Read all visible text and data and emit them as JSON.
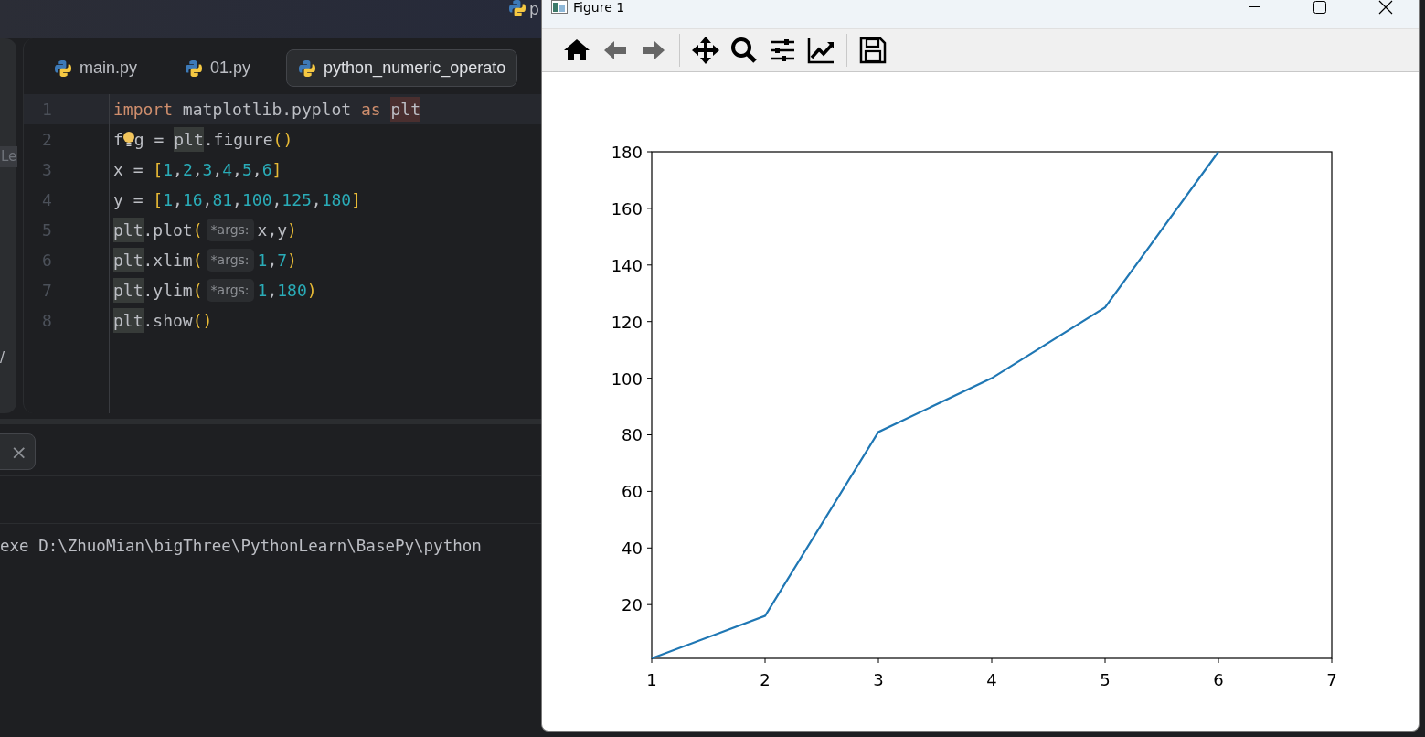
{
  "ide": {
    "title_fragment": "p",
    "side_label": "Le",
    "side_mark": "/",
    "tabs": [
      {
        "label": "main.py",
        "selected": false
      },
      {
        "label": "01.py",
        "selected": false
      },
      {
        "label": "python_numeric_operato",
        "selected": true
      }
    ],
    "code": [
      {
        "number": "1",
        "current": true,
        "tokens": [
          {
            "text": "import",
            "kind": "keyword"
          },
          {
            "text": " matplotlib.pyplot ",
            "kind": "plain"
          },
          {
            "text": "as ",
            "kind": "keyword"
          },
          {
            "text": "plt",
            "kind": "marked"
          }
        ]
      },
      {
        "number": "2",
        "current": false,
        "tokens": [
          {
            "text": "f",
            "kind": "plain"
          },
          {
            "kind": "bulb"
          },
          {
            "text": "g = ",
            "kind": "plain"
          },
          {
            "text": "plt",
            "kind": "usage"
          },
          {
            "text": ".figure",
            "kind": "plain"
          },
          {
            "text": "()",
            "kind": "bracket"
          }
        ]
      },
      {
        "number": "3",
        "current": false,
        "tokens": [
          {
            "text": "x = ",
            "kind": "plain"
          },
          {
            "text": "[",
            "kind": "bracket"
          },
          {
            "text": "1",
            "kind": "number"
          },
          {
            "text": ",",
            "kind": "plain"
          },
          {
            "text": "2",
            "kind": "number"
          },
          {
            "text": ",",
            "kind": "plain"
          },
          {
            "text": "3",
            "kind": "number"
          },
          {
            "text": ",",
            "kind": "plain"
          },
          {
            "text": "4",
            "kind": "number"
          },
          {
            "text": ",",
            "kind": "plain"
          },
          {
            "text": "5",
            "kind": "number"
          },
          {
            "text": ",",
            "kind": "plain"
          },
          {
            "text": "6",
            "kind": "number"
          },
          {
            "text": "]",
            "kind": "bracket"
          }
        ]
      },
      {
        "number": "4",
        "current": false,
        "tokens": [
          {
            "text": "y = ",
            "kind": "plain"
          },
          {
            "text": "[",
            "kind": "bracket"
          },
          {
            "text": "1",
            "kind": "number"
          },
          {
            "text": ",",
            "kind": "plain"
          },
          {
            "text": "16",
            "kind": "number"
          },
          {
            "text": ",",
            "kind": "plain"
          },
          {
            "text": "81",
            "kind": "number"
          },
          {
            "text": ",",
            "kind": "plain"
          },
          {
            "text": "100",
            "kind": "number"
          },
          {
            "text": ",",
            "kind": "plain"
          },
          {
            "text": "125",
            "kind": "number"
          },
          {
            "text": ",",
            "kind": "plain"
          },
          {
            "text": "180",
            "kind": "number"
          },
          {
            "text": "]",
            "kind": "bracket"
          }
        ]
      },
      {
        "number": "5",
        "current": false,
        "tokens": [
          {
            "text": "plt",
            "kind": "usage"
          },
          {
            "text": ".plot",
            "kind": "plain"
          },
          {
            "text": "(",
            "kind": "bracket"
          },
          {
            "text": "*args:",
            "kind": "hint"
          },
          {
            "text": "x,y",
            "kind": "plain"
          },
          {
            "text": ")",
            "kind": "bracket"
          }
        ]
      },
      {
        "number": "6",
        "current": false,
        "tokens": [
          {
            "text": "plt",
            "kind": "usage"
          },
          {
            "text": ".xlim",
            "kind": "plain"
          },
          {
            "text": "(",
            "kind": "bracket"
          },
          {
            "text": "*args:",
            "kind": "hint"
          },
          {
            "text": "1",
            "kind": "number"
          },
          {
            "text": ",",
            "kind": "plain"
          },
          {
            "text": "7",
            "kind": "number"
          },
          {
            "text": ")",
            "kind": "bracket"
          }
        ]
      },
      {
        "number": "7",
        "current": false,
        "tokens": [
          {
            "text": "plt",
            "kind": "usage"
          },
          {
            "text": ".ylim",
            "kind": "plain"
          },
          {
            "text": "(",
            "kind": "bracket"
          },
          {
            "text": "*args:",
            "kind": "hint"
          },
          {
            "text": "1",
            "kind": "number"
          },
          {
            "text": ",",
            "kind": "plain"
          },
          {
            "text": "180",
            "kind": "number"
          },
          {
            "text": ")",
            "kind": "bracket"
          }
        ]
      },
      {
        "number": "8",
        "current": false,
        "tokens": [
          {
            "text": "plt",
            "kind": "usage"
          },
          {
            "text": ".show",
            "kind": "plain"
          },
          {
            "text": "()",
            "kind": "bracket"
          }
        ]
      }
    ],
    "console": {
      "close": "×",
      "output": "exe D:\\ZhuoMian\\bigThree\\PythonLearn\\BasePy\\python"
    }
  },
  "figure_window": {
    "title": "Figure 1",
    "toolbar": [
      {
        "kind": "home"
      },
      {
        "kind": "back"
      },
      {
        "kind": "forward"
      },
      {
        "kind": "separator"
      },
      {
        "kind": "pan"
      },
      {
        "kind": "zoom"
      },
      {
        "kind": "subplots"
      },
      {
        "kind": "axes"
      },
      {
        "kind": "separator"
      },
      {
        "kind": "save"
      }
    ],
    "chart_data": {
      "type": "line",
      "x": [
        1,
        2,
        3,
        4,
        5,
        6
      ],
      "series": [
        {
          "color": "#1f77b4",
          "values": [
            1,
            16,
            81,
            100,
            125,
            180
          ]
        }
      ],
      "xlim": [
        1,
        7
      ],
      "ylim": [
        1,
        180
      ],
      "xticks": [
        1,
        2,
        3,
        4,
        5,
        6,
        7
      ],
      "yticks": [
        20,
        40,
        60,
        80,
        100,
        120,
        140,
        160,
        180
      ]
    }
  }
}
